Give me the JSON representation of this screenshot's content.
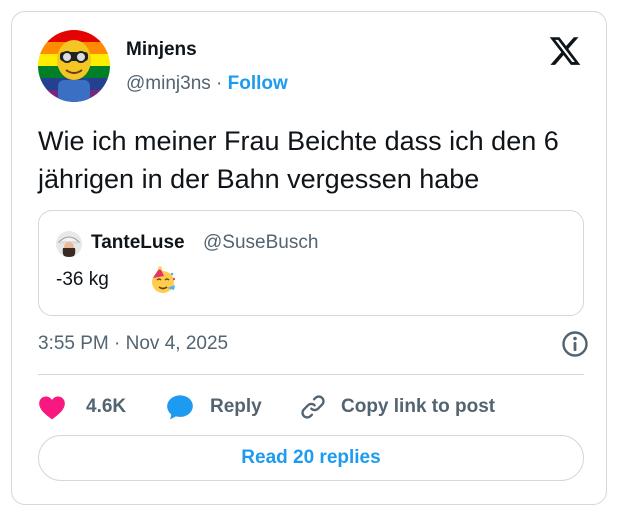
{
  "post": {
    "author_name": "Minjens",
    "author_handle": "@minj3ns",
    "separator": "·",
    "follow_label": "Follow",
    "text": "Wie ich meiner Frau Beichte dass ich den 6 jährigen in der Bahn vergessen habe",
    "timestamp": "3:55 PM · Nov 4, 2025",
    "icons": {
      "logo": "x-logo-icon",
      "info": "info-icon",
      "like": "heart-icon",
      "reply": "reply-bubble-icon",
      "copy": "link-icon"
    }
  },
  "quote": {
    "author_name": "TanteLuse",
    "author_handle": "@SuseBusch",
    "text": "-36 kg",
    "emoji": "party-face-icon"
  },
  "actions": {
    "like_count": "4.6K",
    "reply_label": "Reply",
    "copy_label": "Copy link to post"
  },
  "footer": {
    "read_replies_label": "Read 20 replies"
  },
  "colors": {
    "accent": "#1d9bf0",
    "like": "#f91880",
    "text_primary": "#0f1419",
    "text_secondary": "#536471",
    "border": "#cfd9de"
  }
}
